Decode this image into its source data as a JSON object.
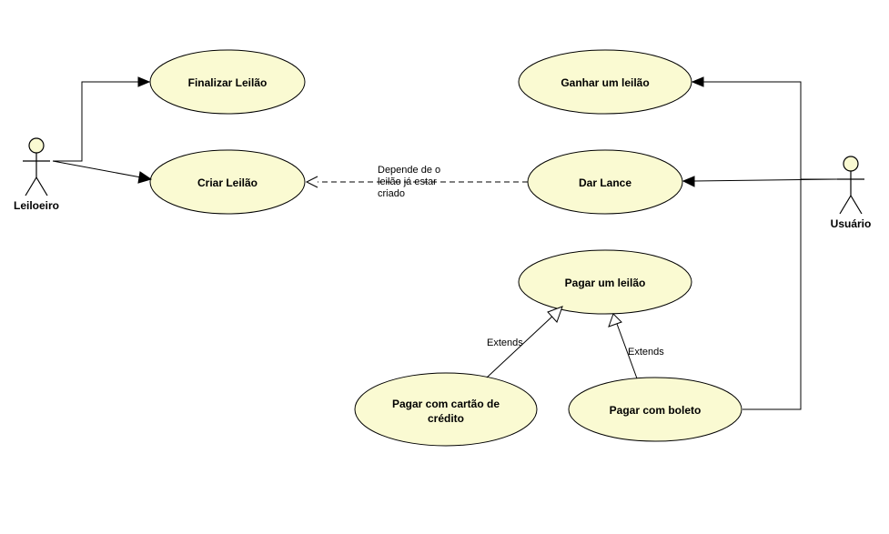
{
  "actors": {
    "leiloeiro": {
      "label": "Leiloeiro"
    },
    "usuario": {
      "label": "Usuário"
    }
  },
  "usecases": {
    "finalizar": {
      "label": "Finalizar Leilão"
    },
    "criar": {
      "label": "Criar Leilão"
    },
    "ganhar": {
      "label": "Ganhar um leilão"
    },
    "lance": {
      "label": "Dar Lance"
    },
    "pagar": {
      "label": "Pagar um leilão"
    },
    "pagar_cartao": {
      "label1": "Pagar com cartão de",
      "label2": "crédito"
    },
    "pagar_boleto": {
      "label": "Pagar com boleto"
    }
  },
  "relations": {
    "depende": {
      "label1": "Depende de o",
      "label2": "leilão já estar",
      "label3": "criado"
    },
    "extends1": {
      "label": "Extends"
    },
    "extends2": {
      "label": "Extends"
    }
  },
  "colors": {
    "usecase_fill": "#fafad2",
    "stroke": "#000000"
  }
}
